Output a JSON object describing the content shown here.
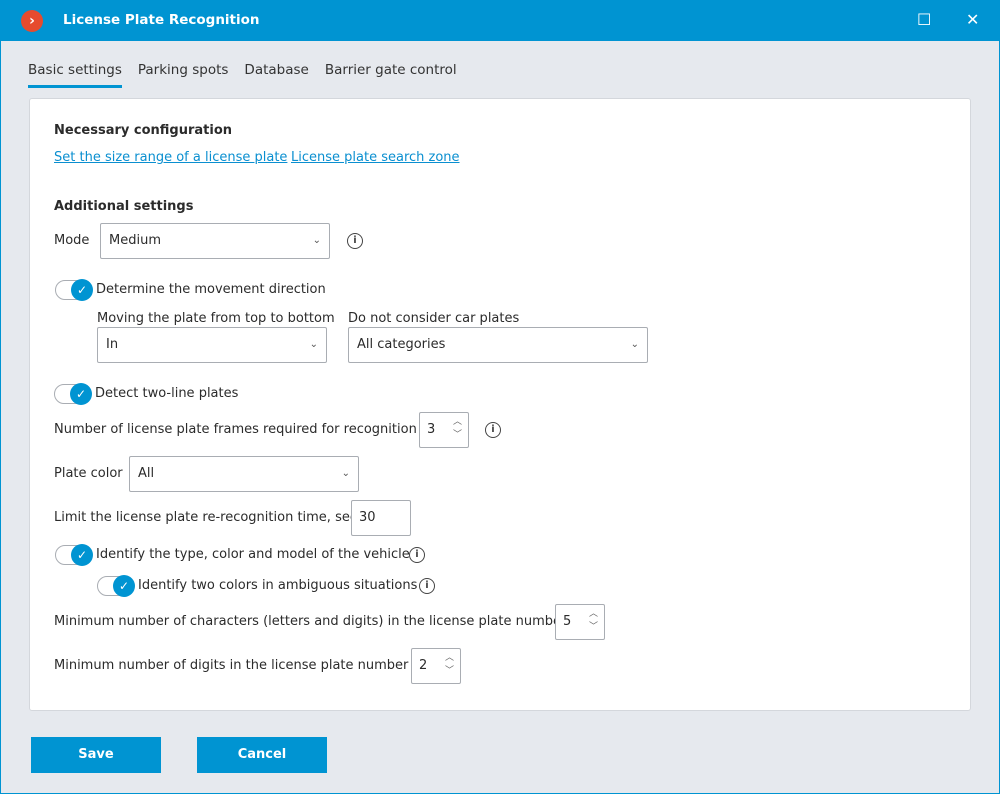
{
  "window": {
    "title": "License Plate Recognition",
    "maximize": "☐",
    "close": "✕"
  },
  "tabs": [
    "Basic settings",
    "Parking spots",
    "Database",
    "Barrier gate control"
  ],
  "necessary": {
    "heading": "Necessary configuration",
    "link1": "Set the size range of a license plate",
    "link2": "License plate search zone"
  },
  "additional": {
    "heading": "Additional settings"
  },
  "mode": {
    "label": "Mode",
    "value": "Medium"
  },
  "direction": {
    "label": "Determine the movement direction",
    "enabled": true,
    "sub1_label": "Moving the plate from top to bottom",
    "sub1_value": "In",
    "sub2_label": "Do not consider car plates",
    "sub2_value": "All categories"
  },
  "two_line": {
    "label": "Detect two-line plates",
    "enabled": true
  },
  "frames": {
    "label": "Number of license plate frames required for recognition",
    "value": "3"
  },
  "plate_color": {
    "label": "Plate color",
    "value": "All"
  },
  "rerecognition": {
    "label": "Limit the license plate re-recognition time, sec.",
    "value": "30"
  },
  "vehicle": {
    "label": "Identify the type, color and model of the vehicle",
    "enabled": true
  },
  "two_colors": {
    "label": "Identify two colors in ambiguous situations",
    "enabled": true
  },
  "min_chars": {
    "label": "Minimum number of characters (letters and digits) in the license plate number",
    "value": "5"
  },
  "min_digits": {
    "label": "Minimum number of digits in the license plate number",
    "value": "2"
  },
  "buttons": {
    "save": "Save",
    "cancel": "Cancel"
  },
  "icons": {
    "info": "i",
    "check": "✓",
    "chevron": "⌄"
  }
}
